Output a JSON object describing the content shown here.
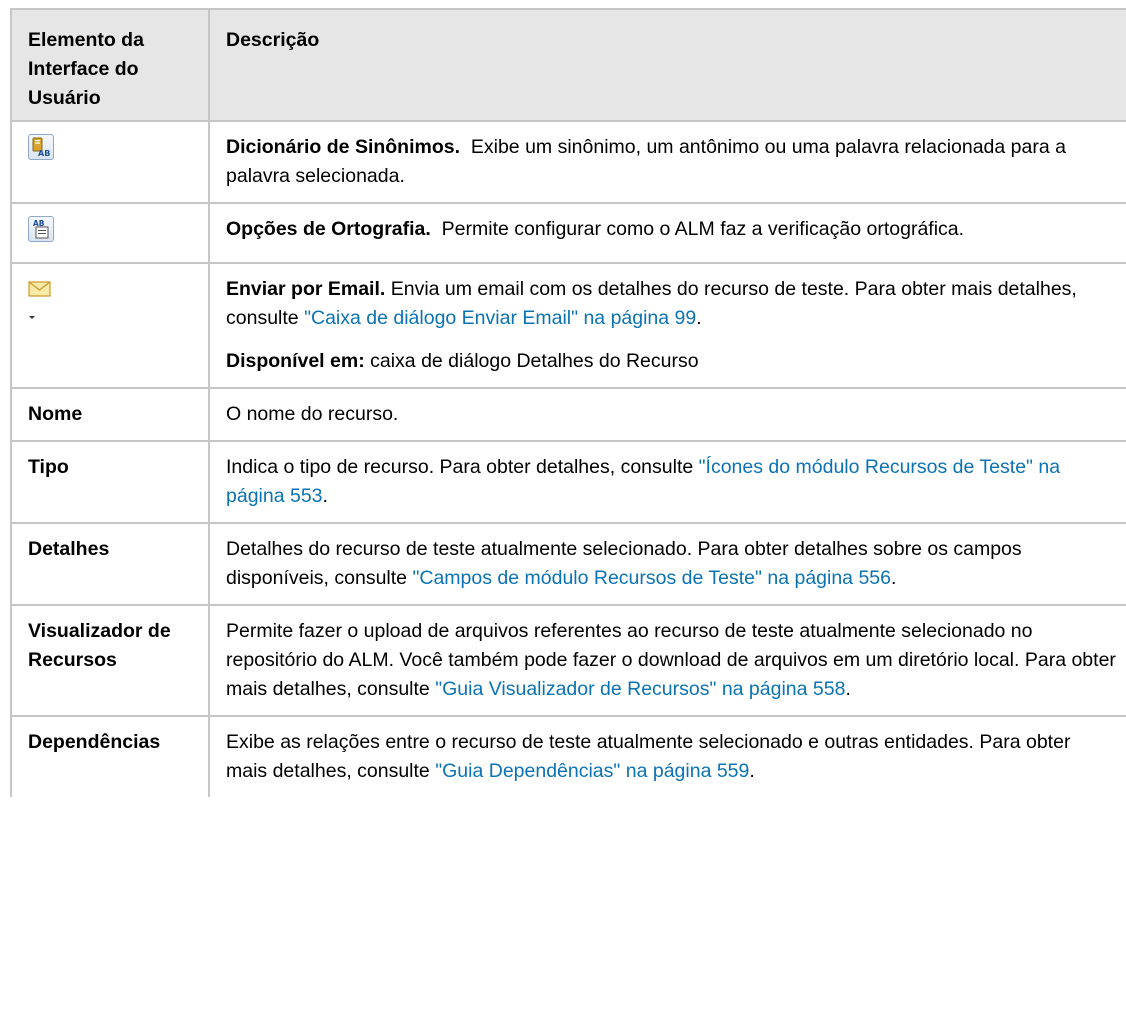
{
  "header": {
    "col1": "Elemento da Interface do Usuário",
    "col2": "Descrição"
  },
  "rows": [
    {
      "icon": "thesaurus-icon",
      "title": "Dicionário de Sinônimos.",
      "text": "Exibe um sinônimo, um antônimo ou uma palavra relacionada para a palavra selecionada."
    },
    {
      "icon": "spelling-options-icon",
      "title": "Opções de Ortografia.",
      "text": "Permite configurar como o ALM faz a verificação ortográfica."
    },
    {
      "icon": "send-email-icon",
      "title": "Enviar por Email.",
      "text": "Envia um email com os detalhes do recurso de teste. Para obter mais detalhes, consulte",
      "link": "\"Caixa de diálogo Enviar Email\" na página 99",
      "after": ".",
      "available_label": "Disponível em:",
      "available_text": "caixa de diálogo Detalhes do Recurso"
    },
    {
      "label": "Nome",
      "text": "O nome do recurso."
    },
    {
      "label": "Tipo",
      "text": "Indica o tipo de recurso. Para obter detalhes, consulte",
      "link": "\"Ícones do módulo Recursos de Teste\" na página 553",
      "after": "."
    },
    {
      "label": "Detalhes",
      "text": "Detalhes do recurso de teste atualmente selecionado. Para obter detalhes sobre os campos disponíveis, consulte",
      "link": "\"Campos de módulo Recursos de Teste\" na página 556",
      "after": "."
    },
    {
      "label": "Visualizador de Recursos",
      "text": "Permite fazer o upload de arquivos referentes ao recurso de teste atualmente selecionado no repositório do ALM. Você também pode fazer o download de arquivos em um diretório local. Para obter mais detalhes, consulte",
      "link": "\"Guia Visualizador de Recursos\" na página 558",
      "after": "."
    },
    {
      "label": "Dependências",
      "text": "Exibe as relações entre o recurso de teste atualmente selecionado e outras entidades. Para obter mais detalhes, consulte",
      "link": "\"Guia Dependências\" na página 559",
      "after": "."
    }
  ]
}
